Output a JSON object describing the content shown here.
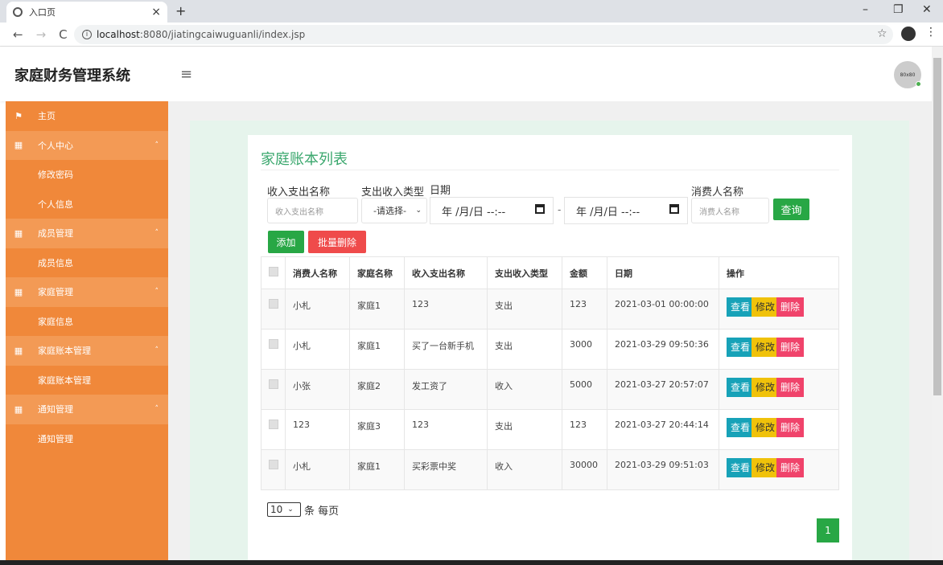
{
  "browser": {
    "tab_title": "入口页",
    "tab_close": "×",
    "new_tab": "+",
    "url_host": "localhost",
    "url_rest": ":8080/jiatingcaiwuguanli/index.jsp",
    "win_min": "–",
    "win_max": "❐",
    "win_close": "✕"
  },
  "header": {
    "brand": "家庭财务管理系统",
    "avatar_text": "80x80"
  },
  "sidebar": {
    "items": [
      {
        "label": "主页",
        "type": "home"
      },
      {
        "label": "个人中心",
        "type": "parent"
      },
      {
        "label": "修改密码",
        "type": "child"
      },
      {
        "label": "个人信息",
        "type": "child"
      },
      {
        "label": "成员管理",
        "type": "parent"
      },
      {
        "label": "成员信息",
        "type": "child"
      },
      {
        "label": "家庭管理",
        "type": "parent"
      },
      {
        "label": "家庭信息",
        "type": "child"
      },
      {
        "label": "家庭账本管理",
        "type": "parent"
      },
      {
        "label": "家庭账本管理",
        "type": "child"
      },
      {
        "label": "通知管理",
        "type": "parent"
      },
      {
        "label": "通知管理",
        "type": "child"
      }
    ]
  },
  "main": {
    "title": "家庭账本列表",
    "filters": {
      "label_name": "收入支出名称",
      "placeholder_name": "收入支出名称",
      "label_type": "支出收入类型",
      "type_selected": "-请选择-",
      "label_date": "日期",
      "date_start": "年 /月/日 --:--",
      "date_end": "年 /月/日 --:--",
      "date_sep": "-",
      "label_consumer": "消费人名称",
      "placeholder_consumer": "消费人名称",
      "query_button": "查询"
    },
    "add_button": "添加",
    "batch_delete_button": "批量删除",
    "table": {
      "headers": [
        "消费人名称",
        "家庭名称",
        "收入支出名称",
        "支出收入类型",
        "金额",
        "日期",
        "操作"
      ],
      "rows": [
        {
          "consumer": "小札",
          "family": "家庭1",
          "name": "123",
          "type": "支出",
          "amount": "123",
          "date": "2021-03-01 00:00:00"
        },
        {
          "consumer": "小札",
          "family": "家庭1",
          "name": "买了一台新手机",
          "type": "支出",
          "amount": "3000",
          "date": "2021-03-29 09:50:36"
        },
        {
          "consumer": "小张",
          "family": "家庭2",
          "name": "发工资了",
          "type": "收入",
          "amount": "5000",
          "date": "2021-03-27 20:57:07"
        },
        {
          "consumer": "123",
          "family": "家庭3",
          "name": "123",
          "type": "支出",
          "amount": "123",
          "date": "2021-03-27 20:44:14"
        },
        {
          "consumer": "小札",
          "family": "家庭1",
          "name": "买彩票中奖",
          "type": "收入",
          "amount": "30000",
          "date": "2021-03-29 09:51:03"
        }
      ],
      "op_view": "查看",
      "op_edit": "修改",
      "op_delete": "删除"
    },
    "pager": {
      "page_size": "10",
      "page_size_suffix": "条 每页",
      "current_page": "1"
    }
  }
}
